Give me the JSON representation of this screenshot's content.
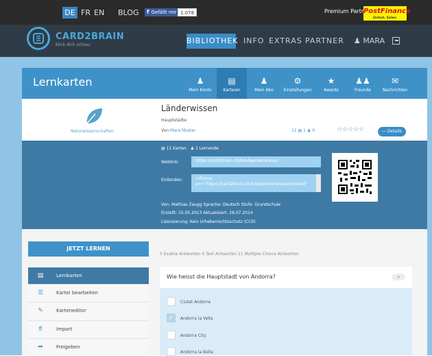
{
  "topbar": {
    "langs": [
      "DE",
      "FR",
      "EN"
    ],
    "blog": "BLOG",
    "fb_like": "Gefällt mir",
    "fb_count": "1.078",
    "premium_partner": "Premium Partner",
    "postfinance": "PostFinance",
    "postfinance_sub": "Einfach. Sicher."
  },
  "nav": {
    "brand": "CARD2BRAIN",
    "slogan": "Klick dich schlau.",
    "links": [
      "BIBLIOTHEK",
      "INFO",
      "EXTRAS",
      "PARTNER"
    ],
    "user": "MARA"
  },
  "header": {
    "title": "Lernkarten",
    "tabs": [
      "Mein Konto",
      "Karteien",
      "Mein Abo",
      "Einstellungen",
      "Awards",
      "Freunde",
      "Nachrichten"
    ]
  },
  "box": {
    "category": "Naturwissenschaften",
    "title": "Länderwissen",
    "subtitle": "Hauptstädte",
    "from_label": "Von",
    "author": "Mara Muster",
    "cards_count": "11",
    "learners_count": "1",
    "rating_count": "0",
    "stars": "☆☆☆☆☆",
    "details_btn": "— Details"
  },
  "embed": {
    "cards": "11 Karten",
    "learners": "1 Lernende",
    "weblink_label": "Weblink:",
    "weblink": "https://card2brain.ch/box/laenderwissen",
    "embed_label": "Einbinden:",
    "embed_line1": "<iframe",
    "embed_line2": "src=\"https://card2brain.ch/box/laenderwissen/embed\"",
    "meta1": "Von: Mathias Zaugg   Sprache: Deutsch   Stufe: Grundschule",
    "meta2": "Erstellt: 15.05.2013   Aktualisiert: 26.07.2014",
    "meta3": "Lizenzierung: Kein Urheberrechtsschutz (CC0)"
  },
  "learn_btn": "JETZT LERNEN",
  "answers_summary": "0 Exakte Antworten   0 Text Antworten   11 Multiple Choice Antworten",
  "sidebar": [
    {
      "label": "Lernkarten",
      "icon": "card-icon"
    },
    {
      "label": "Kartei bearbeiten",
      "icon": "list-icon"
    },
    {
      "label": "Karteneditor",
      "icon": "pencil-icon"
    },
    {
      "label": "Import",
      "icon": "download-icon"
    },
    {
      "label": "Freigeben",
      "icon": "share-icon"
    }
  ],
  "question": {
    "text": "Wie heisst die Hauptstadt von Andorra?",
    "plus": "+",
    "options": [
      {
        "label": "Ciutat Andorra",
        "checked": false
      },
      {
        "label": "Andorra la Vella",
        "checked": true
      },
      {
        "label": "Andorra City",
        "checked": false
      },
      {
        "label": "Andorra la Bella",
        "checked": false
      }
    ]
  },
  "colors": {
    "accent": "#3f92c8",
    "dark": "#2f3b47",
    "embed_bg": "#3f7aa5"
  }
}
